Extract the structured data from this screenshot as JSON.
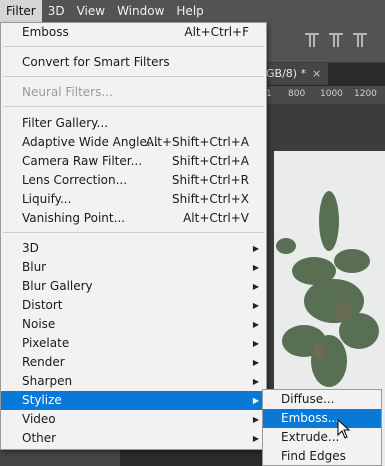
{
  "menubar": {
    "items": [
      "Filter",
      "3D",
      "View",
      "Window",
      "Help"
    ]
  },
  "document": {
    "tab_label": "GB/8) *",
    "close": "×",
    "ruler": [
      "1",
      "800",
      "1000",
      "1200"
    ]
  },
  "filter_menu": {
    "items": [
      {
        "label": "Emboss",
        "shortcut": "Alt+Ctrl+F"
      },
      {
        "label": "Convert for Smart Filters",
        "shortcut": ""
      },
      {
        "label": "Neural Filters...",
        "shortcut": "",
        "disabled": true
      },
      {
        "label": "Filter Gallery...",
        "shortcut": ""
      },
      {
        "label": "Adaptive Wide Angle...",
        "shortcut": "Alt+Shift+Ctrl+A"
      },
      {
        "label": "Camera Raw Filter...",
        "shortcut": "Shift+Ctrl+A"
      },
      {
        "label": "Lens Correction...",
        "shortcut": "Shift+Ctrl+R"
      },
      {
        "label": "Liquify...",
        "shortcut": "Shift+Ctrl+X"
      },
      {
        "label": "Vanishing Point...",
        "shortcut": "Alt+Ctrl+V"
      },
      {
        "label": "3D",
        "submenu": true
      },
      {
        "label": "Blur",
        "submenu": true
      },
      {
        "label": "Blur Gallery",
        "submenu": true
      },
      {
        "label": "Distort",
        "submenu": true
      },
      {
        "label": "Noise",
        "submenu": true
      },
      {
        "label": "Pixelate",
        "submenu": true
      },
      {
        "label": "Render",
        "submenu": true
      },
      {
        "label": "Sharpen",
        "submenu": true
      },
      {
        "label": "Stylize",
        "submenu": true,
        "highlighted": true
      },
      {
        "label": "Video",
        "submenu": true
      },
      {
        "label": "Other",
        "submenu": true
      }
    ]
  },
  "stylize_submenu": {
    "items": [
      {
        "label": "Diffuse..."
      },
      {
        "label": "Emboss...",
        "highlighted": true
      },
      {
        "label": "Extrude..."
      },
      {
        "label": "Find Edges"
      }
    ]
  },
  "colors": {
    "highlight": "#0a78d7",
    "menu_bg": "#f2f2f2",
    "app_bg": "#535353"
  }
}
